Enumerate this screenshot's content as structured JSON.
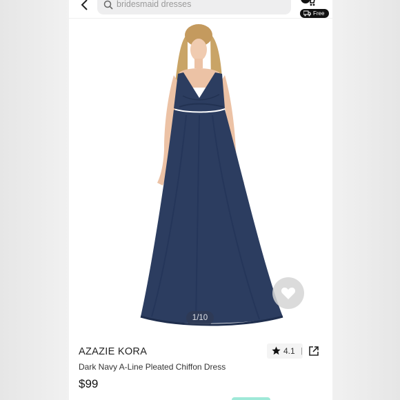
{
  "header": {
    "search_placeholder": "bridesmaid dresses",
    "free_label": "Free"
  },
  "gallery": {
    "counter": "1/10"
  },
  "product": {
    "brand": "AZAZIE KORA",
    "name": "Dark Navy A-Line Pleated Chiffon Dress",
    "price": "$99",
    "rating": "4.1",
    "rating_divider": "|"
  },
  "colors": {
    "dress": "#2c3d60",
    "accent_teal": "#9fe9d8"
  },
  "icons": [
    "back-arrow-icon",
    "search-icon",
    "cart-icon",
    "truck-icon",
    "heart-icon",
    "star-icon",
    "share-icon"
  ]
}
